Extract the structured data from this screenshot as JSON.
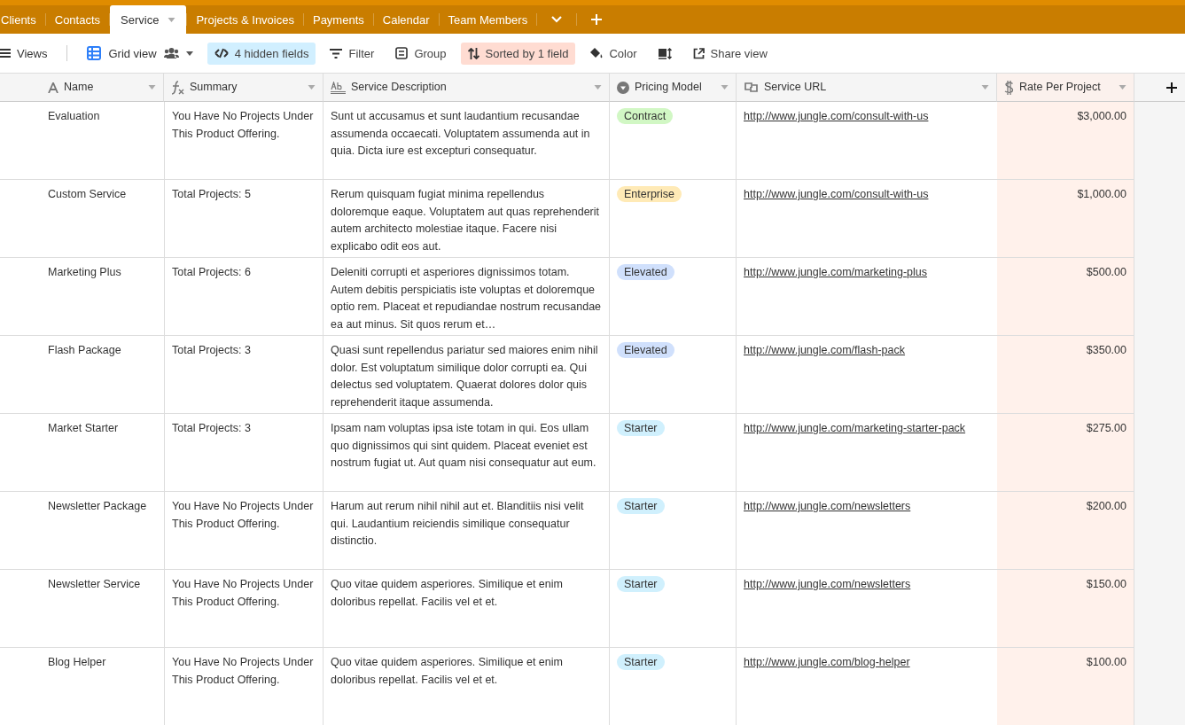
{
  "tabs": [
    {
      "label": "Clients",
      "selected": false
    },
    {
      "label": "Contacts",
      "selected": false
    },
    {
      "label": "Service",
      "selected": true
    },
    {
      "label": "Projects & Invoices",
      "selected": false
    },
    {
      "label": "Payments",
      "selected": false
    },
    {
      "label": "Calendar",
      "selected": false
    },
    {
      "label": "Team Members",
      "selected": false
    }
  ],
  "toolbar": {
    "views": "Views",
    "view_name": "Grid view",
    "hidden_fields": "4 hidden fields",
    "filter": "Filter",
    "group": "Group",
    "sort": "Sorted by 1 field",
    "color_label": "Color",
    "share": "Share view"
  },
  "table": {
    "columns": [
      {
        "label": "Name",
        "kind": "text",
        "sorted": false
      },
      {
        "label": "Summary",
        "kind": "formula",
        "sorted": false
      },
      {
        "label": "Service Description",
        "kind": "longtext",
        "sorted": false
      },
      {
        "label": "Pricing Model",
        "kind": "select",
        "sorted": false
      },
      {
        "label": "Service URL",
        "kind": "url",
        "sorted": false
      },
      {
        "label": "Rate Per Project",
        "kind": "currency",
        "sorted": true
      }
    ],
    "rows": [
      {
        "name": "Evaluation",
        "summary": "You Have No Projects Under This Product Offering.",
        "description": "Sunt ut accusamus et sunt laudantium recusandae assumenda occaecati. Voluptatem assumenda aut in quia. Dicta iure est excepturi consequatur.",
        "pricing": {
          "label": "Contract",
          "color": "#d1f7c4"
        },
        "url": "http://www.jungle.com/consult-with-us",
        "rate": "$3,000.00"
      },
      {
        "name": "Custom Service",
        "summary": "Total Projects: 5",
        "description": "Rerum quisquam fugiat minima repellendus doloremque eaque. Voluptatem aut quas reprehenderit autem architecto molestiae itaque. Facere nisi explicabo odit eos aut.",
        "pricing": {
          "label": "Enterprise",
          "color": "#ffeab6"
        },
        "url": "http://www.jungle.com/consult-with-us",
        "rate": "$1,000.00"
      },
      {
        "name": "Marketing Plus",
        "summary": "Total Projects: 6",
        "description": "Deleniti corrupti et asperiores dignissimos totam. Autem debitis perspiciatis iste voluptas et doloremque optio rem. Placeat et repudiandae nostrum recusandae ea aut minus. Sit quos rerum et…",
        "pricing": {
          "label": "Elevated",
          "color": "#d0e0fc"
        },
        "url": "http://www.jungle.com/marketing-plus",
        "rate": "$500.00"
      },
      {
        "name": "Flash Package",
        "summary": "Total Projects: 3",
        "description": "Quasi sunt repellendus pariatur sed maiores enim nihil dolor. Est voluptatum similique dolor corrupti ea. Qui delectus sed voluptatem. Quaerat dolores dolor quis reprehenderit itaque assumenda.",
        "pricing": {
          "label": "Elevated",
          "color": "#d0e0fc"
        },
        "url": "http://www.jungle.com/flash-pack",
        "rate": "$350.00"
      },
      {
        "name": "Market Starter",
        "summary": "Total Projects: 3",
        "description": "Ipsam nam voluptas ipsa iste totam in qui. Eos ullam quo dignissimos qui sint quidem. Placeat eveniet est nostrum fugiat ut. Aut quam nisi consequatur aut eum.",
        "pricing": {
          "label": "Starter",
          "color": "#d0f0fd"
        },
        "url": "http://www.jungle.com/marketing-starter-pack",
        "rate": "$275.00"
      },
      {
        "name": "Newsletter Package",
        "summary": "You Have No Projects Under This Product Offering.",
        "description": "Harum aut rerum nihil nihil aut et. Blanditiis nisi velit qui. Laudantium reiciendis similique consequatur distinctio.",
        "pricing": {
          "label": "Starter",
          "color": "#d0f0fd"
        },
        "url": "http://www.jungle.com/newsletters",
        "rate": "$200.00"
      },
      {
        "name": "Newsletter Service",
        "summary": "You Have No Projects Under This Product Offering.",
        "description": "Quo vitae quidem asperiores. Similique et enim doloribus repellat. Facilis vel et et.",
        "pricing": {
          "label": "Starter",
          "color": "#d0f0fd"
        },
        "url": "http://www.jungle.com/newsletters",
        "rate": "$150.00"
      },
      {
        "name": "Blog Helper",
        "summary": "You Have No Projects Under This Product Offering.",
        "description": "Quo vitae quidem asperiores. Similique et enim doloribus repellat. Facilis vel et et.",
        "pricing": {
          "label": "Starter",
          "color": "#d0f0fd"
        },
        "url": "http://www.jungle.com/blog-helper",
        "rate": "$100.00"
      }
    ]
  }
}
